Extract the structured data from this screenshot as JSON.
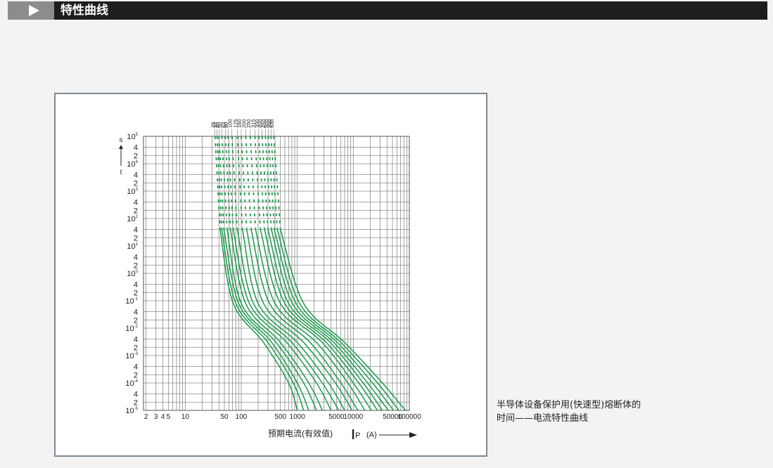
{
  "header": {
    "title": "特性曲线",
    "bar_color": "#1e1e1e",
    "arrow_box_color": "#8c8c8c"
  },
  "caption": {
    "line1": "半导体设备保护用(快速型)熔断体的",
    "line2": "时间——电流特性曲线"
  },
  "chart_data": {
    "type": "line",
    "x_scale": "log",
    "y_scale": "log",
    "xlim": [
      1.8,
      100000
    ],
    "ylim": [
      1e-05,
      100000
    ],
    "grid": true,
    "curve_color": "#1a9a4a",
    "ylabel_top": "s",
    "ylabel_axis": "t",
    "xlabel": {
      "main": "预期电流(有效值)",
      "symbol": "I",
      "sub": "P",
      "unit": "(A)"
    },
    "x_ticks": [
      {
        "value": 2,
        "label": "2"
      },
      {
        "value": 3,
        "label": "3"
      },
      {
        "value": 4,
        "label": "4"
      },
      {
        "value": 5,
        "label": "5"
      },
      {
        "value": 10,
        "label": "10"
      },
      {
        "value": 50,
        "label": "50"
      },
      {
        "value": 100,
        "label": "100"
      },
      {
        "value": 500,
        "label": "500"
      },
      {
        "value": 1000,
        "label": "1000"
      },
      {
        "value": 5000,
        "label": "5000"
      },
      {
        "value": 10000,
        "label": "10000"
      },
      {
        "value": 50000,
        "label": "50000"
      },
      {
        "value": 100000,
        "label": "100000"
      }
    ],
    "y_decade_labels": [
      {
        "exp": 5,
        "base": "10",
        "sup": "5"
      },
      {
        "exp": 4,
        "base": "10",
        "sup": "4"
      },
      {
        "exp": 3,
        "base": "10",
        "sup": "3"
      },
      {
        "exp": 2,
        "base": "10",
        "sup": "2"
      },
      {
        "exp": 1,
        "base": "10",
        "sup": "1"
      },
      {
        "exp": 0,
        "base": "10",
        "sup": "0"
      },
      {
        "exp": -1,
        "base": "10",
        "sup": "-1"
      },
      {
        "exp": -2,
        "base": "10",
        "sup": "-2"
      },
      {
        "exp": -3,
        "base": "10",
        "sup": "-3"
      },
      {
        "exp": -4,
        "base": "10",
        "sup": "-4"
      },
      {
        "exp": -5,
        "base": "10",
        "sup": "-5"
      }
    ],
    "y_minor_labels": [
      "4",
      "2"
    ],
    "series": [
      {
        "name": "25",
        "points": [
          [
            34,
            100000
          ],
          [
            42,
            40
          ],
          [
            72,
            0.08
          ],
          [
            250,
            0.003
          ],
          [
            700,
            0.0001
          ],
          [
            1000,
            1e-05
          ]
        ]
      },
      {
        "name": "32",
        "points": [
          [
            37,
            100000
          ],
          [
            45,
            40
          ],
          [
            80,
            0.08
          ],
          [
            300,
            0.003
          ],
          [
            850,
            0.0001
          ],
          [
            1300,
            1e-05
          ]
        ]
      },
      {
        "name": "40",
        "points": [
          [
            40,
            100000
          ],
          [
            49,
            40
          ],
          [
            90,
            0.08
          ],
          [
            350,
            0.003
          ],
          [
            1000,
            0.0001
          ],
          [
            1600,
            1e-05
          ]
        ]
      },
      {
        "name": "50",
        "points": [
          [
            45,
            100000
          ],
          [
            56,
            40
          ],
          [
            100,
            0.08
          ],
          [
            420,
            0.003
          ],
          [
            1300,
            0.0001
          ],
          [
            2200,
            1e-05
          ]
        ]
      },
      {
        "name": "63",
        "points": [
          [
            52,
            100000
          ],
          [
            64,
            40
          ],
          [
            120,
            0.08
          ],
          [
            500,
            0.003
          ],
          [
            1600,
            0.0001
          ],
          [
            2800,
            1e-05
          ]
        ]
      },
      {
        "name": "80",
        "points": [
          [
            58,
            100000
          ],
          [
            72,
            40
          ],
          [
            140,
            0.08
          ],
          [
            650,
            0.003
          ],
          [
            2200,
            0.0001
          ],
          [
            4000,
            1e-05
          ]
        ]
      },
      {
        "name": "100",
        "points": [
          [
            68,
            100000
          ],
          [
            85,
            40
          ],
          [
            165,
            0.08
          ],
          [
            800,
            0.003
          ],
          [
            2800,
            0.0001
          ],
          [
            5500,
            1e-05
          ]
        ]
      },
      {
        "name": "125",
        "points": [
          [
            85,
            100000
          ],
          [
            105,
            40
          ],
          [
            200,
            0.08
          ],
          [
            1000,
            0.003
          ],
          [
            3600,
            0.0001
          ],
          [
            7000,
            1e-05
          ]
        ]
      },
      {
        "name": "160",
        "points": [
          [
            100,
            100000
          ],
          [
            125,
            40
          ],
          [
            250,
            0.08
          ],
          [
            1300,
            0.003
          ],
          [
            4800,
            0.0001
          ],
          [
            9500,
            1e-05
          ]
        ]
      },
      {
        "name": "200",
        "points": [
          [
            120,
            100000
          ],
          [
            150,
            40
          ],
          [
            320,
            0.08
          ],
          [
            1700,
            0.003
          ],
          [
            6000,
            0.0001
          ],
          [
            12000,
            1e-05
          ]
        ]
      },
      {
        "name": "250",
        "points": [
          [
            145,
            100000
          ],
          [
            180,
            40
          ],
          [
            400,
            0.08
          ],
          [
            2200,
            0.003
          ],
          [
            8000,
            0.0001
          ],
          [
            16000,
            1e-05
          ]
        ]
      },
      {
        "name": "315",
        "points": [
          [
            175,
            100000
          ],
          [
            220,
            40
          ],
          [
            500,
            0.08
          ],
          [
            2800,
            0.003
          ],
          [
            10000,
            0.0001
          ],
          [
            21000,
            1e-05
          ]
        ]
      },
      {
        "name": "350",
        "points": [
          [
            205,
            100000
          ],
          [
            260,
            40
          ],
          [
            600,
            0.08
          ],
          [
            3300,
            0.003
          ],
          [
            12500,
            0.0001
          ],
          [
            27000,
            1e-05
          ]
        ]
      },
      {
        "name": "400",
        "points": [
          [
            235,
            100000
          ],
          [
            300,
            40
          ],
          [
            700,
            0.08
          ],
          [
            3900,
            0.003
          ],
          [
            15000,
            0.0001
          ],
          [
            33000,
            1e-05
          ]
        ]
      },
      {
        "name": "450",
        "points": [
          [
            270,
            100000
          ],
          [
            345,
            40
          ],
          [
            820,
            0.08
          ],
          [
            4500,
            0.003
          ],
          [
            18000,
            0.0001
          ],
          [
            42000,
            1e-05
          ]
        ]
      },
      {
        "name": "500",
        "points": [
          [
            305,
            100000
          ],
          [
            390,
            40
          ],
          [
            950,
            0.08
          ],
          [
            5200,
            0.003
          ],
          [
            22000,
            0.0001
          ],
          [
            52000,
            1e-05
          ]
        ]
      },
      {
        "name": "560",
        "points": [
          [
            340,
            100000
          ],
          [
            440,
            40
          ],
          [
            1100,
            0.08
          ],
          [
            6000,
            0.003
          ],
          [
            27000,
            0.0001
          ],
          [
            65000,
            1e-05
          ]
        ]
      },
      {
        "name": "630",
        "points": [
          [
            380,
            100000
          ],
          [
            500,
            40
          ],
          [
            1300,
            0.08
          ],
          [
            7000,
            0.003
          ],
          [
            33000,
            0.0001
          ],
          [
            85000,
            1e-05
          ]
        ]
      }
    ]
  }
}
